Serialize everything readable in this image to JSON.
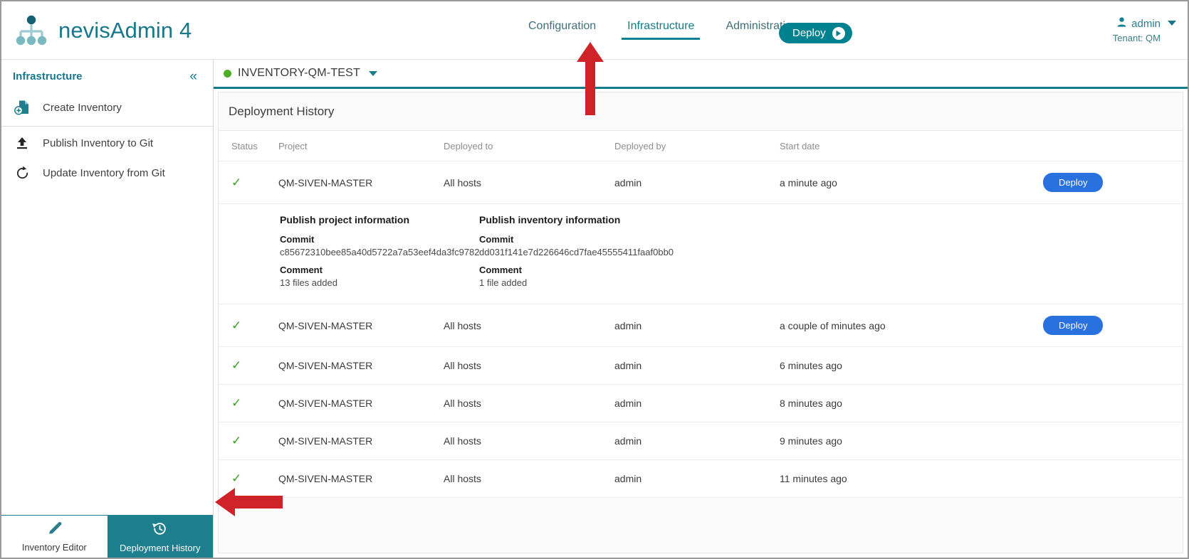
{
  "app": {
    "brand_name": "nevisAdmin 4",
    "logo_icon": "hierarchy-logo-icon"
  },
  "nav": {
    "items": [
      {
        "label": "Configuration",
        "active": false
      },
      {
        "label": "Infrastructure",
        "active": true
      },
      {
        "label": "Administration",
        "active": false
      }
    ],
    "deploy_button": {
      "label": "Deploy",
      "icon": "play-circle-icon",
      "color": "#00818f"
    }
  },
  "user": {
    "avatar_icon": "user-icon",
    "name": "admin",
    "tenant": "Tenant: QM",
    "caret_icon": "chevron-down-icon"
  },
  "sidebar": {
    "title": "Infrastructure",
    "collapse_icon": "chevron-double-left-icon",
    "collapse_label": "«",
    "items": [
      {
        "label": "Create Inventory",
        "icon": "file-add-icon"
      },
      {
        "label": "Publish Inventory to Git",
        "icon": "upload-icon"
      },
      {
        "label": "Update Inventory from Git",
        "icon": "refresh-icon"
      }
    ],
    "bottom_tabs": [
      {
        "label": "Inventory Editor",
        "icon": "pencil-icon",
        "active": false
      },
      {
        "label": "Deployment History",
        "icon": "history-clock-icon",
        "active": true
      }
    ]
  },
  "inventory_bar": {
    "status_dot_color": "#4cae24",
    "name": "INVENTORY-QM-TEST",
    "caret_icon": "chevron-down-icon"
  },
  "panel": {
    "title": "Deployment History",
    "columns": [
      "Status",
      "Project",
      "Deployed to",
      "Deployed by",
      "Start date",
      ""
    ],
    "rows": [
      {
        "status_icon": "check-icon",
        "project": "QM-SIVEN-MASTER",
        "deployed_to": "All hosts",
        "deployed_by": "admin",
        "start_date": "a minute ago",
        "action_label": "Deploy",
        "has_action": true,
        "expanded": true
      },
      {
        "status_icon": "check-icon",
        "project": "QM-SIVEN-MASTER",
        "deployed_to": "All hosts",
        "deployed_by": "admin",
        "start_date": "a couple of minutes ago",
        "action_label": "Deploy",
        "has_action": true,
        "expanded": false
      },
      {
        "status_icon": "check-icon",
        "project": "QM-SIVEN-MASTER",
        "deployed_to": "All hosts",
        "deployed_by": "admin",
        "start_date": "6 minutes ago",
        "action_label": "",
        "has_action": false,
        "expanded": false
      },
      {
        "status_icon": "check-icon",
        "project": "QM-SIVEN-MASTER",
        "deployed_to": "All hosts",
        "deployed_by": "admin",
        "start_date": "8 minutes ago",
        "action_label": "",
        "has_action": false,
        "expanded": false
      },
      {
        "status_icon": "check-icon",
        "project": "QM-SIVEN-MASTER",
        "deployed_to": "All hosts",
        "deployed_by": "admin",
        "start_date": "9 minutes ago",
        "action_label": "",
        "has_action": false,
        "expanded": false
      },
      {
        "status_icon": "check-icon",
        "project": "QM-SIVEN-MASTER",
        "deployed_to": "All hosts",
        "deployed_by": "admin",
        "start_date": "11 minutes ago",
        "action_label": "",
        "has_action": false,
        "expanded": false
      }
    ],
    "detail": {
      "project_section": {
        "heading": "Publish project information",
        "commit_label": "Commit",
        "commit_value": "c85672310bee85a40d5722a7a53eef4da3fc9782",
        "comment_label": "Comment",
        "comment_value": "13 files added"
      },
      "inventory_section": {
        "heading": "Publish inventory information",
        "commit_label": "Commit",
        "commit_value": "dd031f141e7d226646cd7fae45555411faaf0bb0",
        "comment_label": "Comment",
        "comment_value": "1 file added"
      }
    }
  },
  "annotations": {
    "arrow_color": "#cf2229",
    "arrow_up_target": "Infrastructure",
    "arrow_left_target": "Deployment History"
  }
}
